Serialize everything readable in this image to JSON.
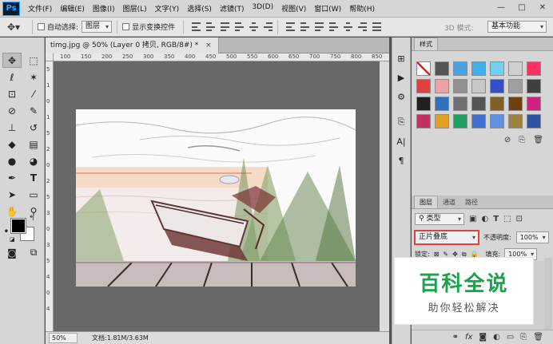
{
  "app": {
    "logo": "Ps"
  },
  "menu": [
    "文件(F)",
    "编辑(E)",
    "图像(I)",
    "图层(L)",
    "文字(Y)",
    "选择(S)",
    "滤镜(T)",
    "3D(D)",
    "视图(V)",
    "窗口(W)",
    "帮助(H)"
  ],
  "window_controls": {
    "minimize": "—",
    "maximize": "□",
    "close": "✕"
  },
  "options": {
    "auto_select_label": "自动选择:",
    "auto_select_value": "图层",
    "show_transform_label": "显示变换控件",
    "mode_3d_label": "3D 模式:",
    "workspace": "基本功能"
  },
  "document": {
    "tab_title": "timg.jpg @ 50% (Layer 0 拷贝, RGB/8#) *",
    "close": "×",
    "zoom": "50%",
    "info": "文档:1.81M/3.63M",
    "ruler_h": [
      "100",
      "150",
      "200",
      "250",
      "300",
      "350",
      "400",
      "450",
      "500",
      "550",
      "600",
      "650",
      "700",
      "750",
      "800",
      "850"
    ],
    "ruler_v": [
      "5",
      "1",
      "0",
      "1",
      "5",
      "2",
      "0",
      "2",
      "5",
      "3",
      "0",
      "3",
      "5",
      "4",
      "0",
      "4"
    ]
  },
  "styles_panel": {
    "tab": "样式",
    "swatches": [
      "#ffffff",
      "#555555",
      "#4aa0e0",
      "#3fb0e8",
      "#6fd0f0",
      "#d0d0d0",
      "#ff3060",
      "#e04040",
      "#f0a0a0",
      "#909090",
      "#c8c8c8",
      "#3050c8",
      "#a0a0a0",
      "#404040",
      "#202020",
      "#3070c0",
      "#707070",
      "#555555",
      "#806020",
      "#704010",
      "#d02080",
      "#c03060",
      "#e0a020",
      "#20a060",
      "#4070d0",
      "#6090e0",
      "#a08040",
      "#3050a0"
    ]
  },
  "layers_panel": {
    "tabs": [
      "图层",
      "通道",
      "路径"
    ],
    "filter_kind": "类型",
    "blend_mode": "正片叠底",
    "opacity_label": "不透明度:",
    "opacity_value": "100%",
    "lock_label": "锁定:",
    "fill_label": "填充:",
    "fill_value": "100%"
  },
  "watermark": {
    "title": "百科全说",
    "subtitle": "助你轻松解决"
  }
}
